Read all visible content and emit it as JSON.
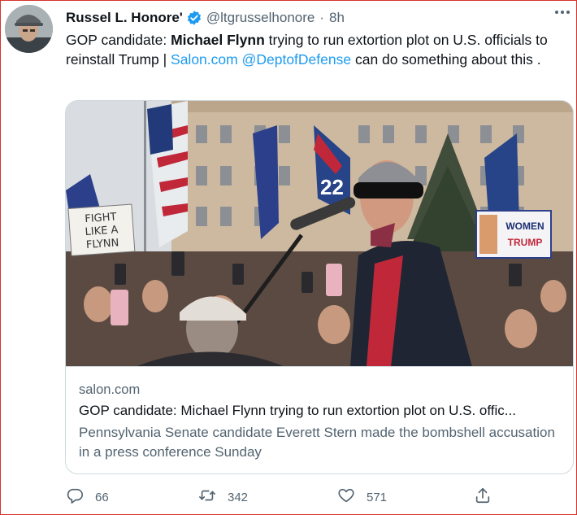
{
  "tweet": {
    "author_name": "Russel L. Honore'",
    "handle": "@ltgrusselhonore",
    "separator": "·",
    "time": "8h",
    "text": {
      "part1": "GOP candidate: ",
      "bold1": "Michael Flynn",
      "part2": " trying to run extortion plot on U.S. officials to reinstall Trump | ",
      "link1": "Salon.com",
      "space": " ",
      "link2": "@DeptofDefense",
      "part3": " can do something about this ."
    }
  },
  "card": {
    "image_text": {
      "sign1_line1": "FIGHT",
      "sign1_line2": "LIKE A",
      "sign1_line3": "FLYNN",
      "sign2_line1": "WOMEN",
      "sign2_line2": "TRUMP",
      "flag_number": "22"
    },
    "domain": "salon.com",
    "title": "GOP candidate: Michael Flynn trying to run extortion plot on U.S. offic...",
    "description": "Pennsylvania Senate candidate Everett Stern made the bombshell accusation in a press conference Sunday"
  },
  "actions": {
    "replies": "66",
    "retweets": "342",
    "likes": "571"
  },
  "icons": {
    "verified": "verified-badge-icon",
    "more": "more-dots-icon",
    "reply": "reply-icon",
    "retweet": "retweet-icon",
    "like": "heart-icon",
    "share": "share-icon"
  },
  "colors": {
    "link": "#1d9bf0",
    "secondary_text": "#536471",
    "frame_border": "#d6322b"
  }
}
